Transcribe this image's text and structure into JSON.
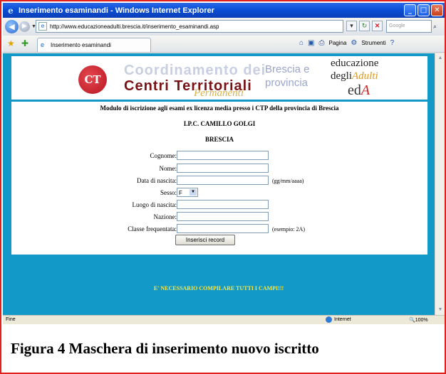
{
  "window": {
    "title": "Inserimento esaminandi - Windows Internet Explorer",
    "controls": [
      "_",
      "□",
      "✕"
    ]
  },
  "address_bar": {
    "url": "http://www.educazioneadulti.brescia.it/inserimento_esaminandi.asp",
    "search_placeholder": "Google"
  },
  "tab": {
    "label": "Inserimento esaminandi"
  },
  "command_bar": {
    "page_label": "Pagina",
    "tools_label": "Strumenti"
  },
  "banner": {
    "org_line1": "Coordinamento dei",
    "org_line2": "Centri Territoriali",
    "org_line3": "Permanenti",
    "province_line1": "Brescia e",
    "province_line2": "provincia",
    "eda_line1": "educazione",
    "eda_line2_a": "degli",
    "eda_line2_b": "Adulti",
    "eda_line3_a": "ed",
    "eda_line3_b": "A"
  },
  "form": {
    "intro": "Modulo di iscrizione agli esami ex licenza media presso i CTP della provincia di Brescia",
    "school": "I.P.C. CAMILLO GOLGI",
    "city": "BRESCIA",
    "fields": {
      "cognome": "Cognome:",
      "nome": "Nome:",
      "data_nascita": "Data di nascita:",
      "data_hint": "(gg/mm/aaaa)",
      "sesso": "Sesso:",
      "sesso_value": "F",
      "luogo_nascita": "Luogo di nascita:",
      "nazione": "Nazione:",
      "classe": "Classe frequentata:",
      "classe_hint": "(esempio: 2A)"
    },
    "submit_label": "Inserisci record"
  },
  "warning": "E' NECESSARIO COMPILARE TUTTI I CAMPI!!!",
  "status_bar": {
    "left": "Fine",
    "zone": "Internet",
    "zoom": "100%"
  },
  "caption": "Figura 4 Maschera di inserimento nuovo iscritto"
}
